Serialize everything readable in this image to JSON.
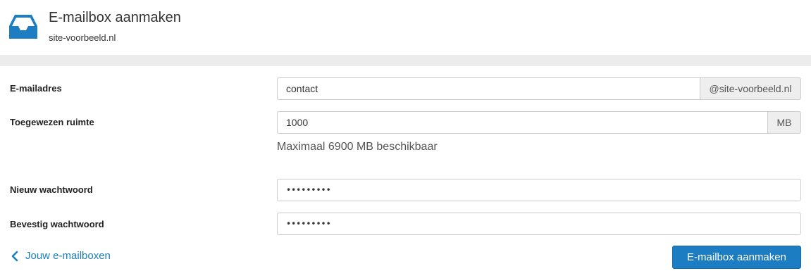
{
  "header": {
    "icon": "inbox-tray-icon",
    "title": "E-mailbox aanmaken",
    "subtitle": "site-voorbeeld.nl",
    "accent_color": "#1c7dc3"
  },
  "form": {
    "email": {
      "label": "E-mailadres",
      "value": "contact",
      "domain_suffix": "@site-voorbeeld.nl"
    },
    "quota": {
      "label": "Toegewezen ruimte",
      "value": "1000",
      "unit": "MB",
      "help": "Maximaal 6900 MB beschikbaar"
    },
    "new_password": {
      "label": "Nieuw wachtwoord",
      "value": "•••••••••"
    },
    "confirm_password": {
      "label": "Bevestig wachtwoord",
      "value": "•••••••••"
    }
  },
  "footer": {
    "back_icon": "chevron-left-icon",
    "back_link": "Jouw e-mailboxen",
    "submit_label": "E-mailbox aanmaken"
  }
}
